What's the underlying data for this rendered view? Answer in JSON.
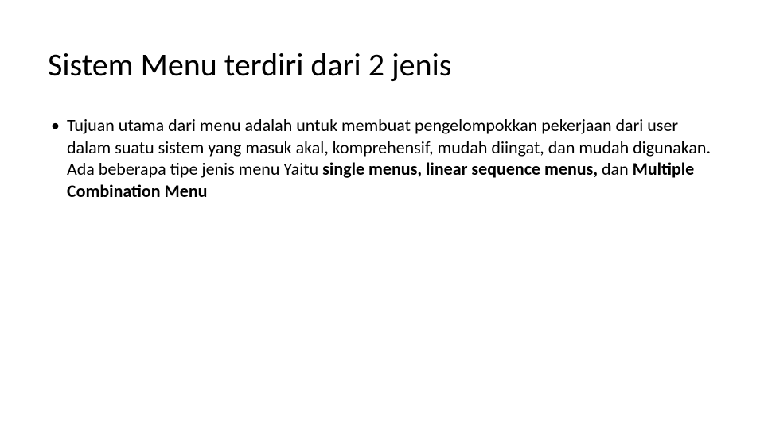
{
  "slide": {
    "title": "Sistem Menu terdiri dari 2 jenis",
    "bullet": {
      "prefix": "Tujuan utama dari menu adalah untuk membuat pengelompokkan pekerjaan dari user dalam suatu sistem yang masuk akal, komprehensif, mudah diingat, dan mudah digunakan. Ada beberapa tipe jenis menu Yaitu ",
      "bold1": "single menus, linear sequence menus, ",
      "mid": "dan ",
      "bold2": "Multiple Combination Menu"
    }
  }
}
